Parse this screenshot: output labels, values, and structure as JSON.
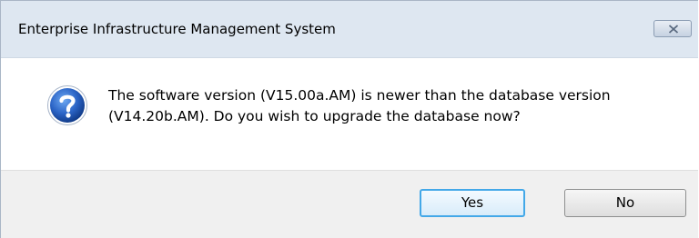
{
  "window": {
    "title": "Enterprise Infrastructure Management System"
  },
  "titlebar": {
    "close_icon": "close-icon"
  },
  "message": {
    "icon": "question-icon",
    "line1": "The software version (V15.00a.AM) is newer than the database version",
    "line2": "(V14.20b.AM).  Do you wish to upgrade the database now?"
  },
  "buttons": {
    "yes_label": "Yes",
    "no_label": "No"
  },
  "colors": {
    "titlebar_bg": "#dee7f1",
    "footer_bg": "#f0f0f0",
    "default_button_border": "#43a8e8",
    "icon_blue": "#2b64c6"
  }
}
